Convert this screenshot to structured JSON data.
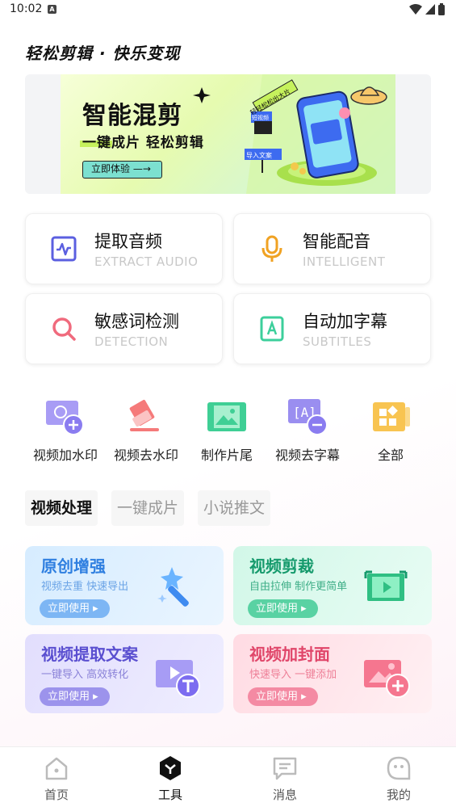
{
  "status_bar": {
    "time": "10:02",
    "notification_glyph": "A"
  },
  "slogan": "轻松剪辑 · 快乐变现",
  "banner": {
    "title": "智能混剪",
    "subtitle": "一键成片  轻松剪辑",
    "button": "立即体验 —→",
    "ribbon": "轻轻松松出大片",
    "tag1": "短视频",
    "tag2": "导入文案"
  },
  "features": [
    {
      "title": "提取音频",
      "subtitle": "EXTRACT AUDIO",
      "icon": "waveform-icon",
      "color": "#5b5fe0"
    },
    {
      "title": "智能配音",
      "subtitle": "INTELLIGENT",
      "icon": "microphone-icon",
      "color": "#f0a223"
    },
    {
      "title": "敏感词检测",
      "subtitle": "DETECTION",
      "icon": "search-icon",
      "color": "#f06a7d"
    },
    {
      "title": "自动加字幕",
      "subtitle": "SUBTITLES",
      "icon": "subtitle-icon",
      "color": "#3ccf9b"
    }
  ],
  "tools": [
    {
      "label": "视频加水印",
      "icon": "add-watermark-icon"
    },
    {
      "label": "视频去水印",
      "icon": "eraser-icon"
    },
    {
      "label": "制作片尾",
      "icon": "film-image-icon"
    },
    {
      "label": "视频去字幕",
      "icon": "remove-subtitle-icon"
    },
    {
      "label": "全部",
      "icon": "all-grid-icon"
    }
  ],
  "tabs": [
    "视频处理",
    "一键成片",
    "小说推文"
  ],
  "process_cards": [
    {
      "title": "原创增强",
      "subtitle": "视频去重 快速导出",
      "button": "立即使用",
      "icon": "magic-wand-icon",
      "title_color": "#2f7fe0",
      "sub_color": "#6aa3e6",
      "btn_color": "#7db6f4"
    },
    {
      "title": "视频剪裁",
      "subtitle": "自由拉伸 制作更简单",
      "button": "立即使用",
      "icon": "crop-video-icon",
      "title_color": "#159a6c",
      "sub_color": "#3eae87",
      "btn_color": "#59d2a3"
    },
    {
      "title": "视频提取文案",
      "subtitle": "一键导入 高效转化",
      "button": "立即使用",
      "icon": "extract-text-icon",
      "title_color": "#5a4fd0",
      "sub_color": "#8a82d8",
      "btn_color": "#9c93ec"
    },
    {
      "title": "视频加封面",
      "subtitle": "快速导入 一键添加",
      "button": "立即使用",
      "icon": "add-cover-icon",
      "title_color": "#e0466a",
      "sub_color": "#ee7f97",
      "btn_color": "#f48aa3"
    }
  ],
  "bottom_nav": [
    {
      "label": "首页",
      "icon": "home-icon"
    },
    {
      "label": "工具",
      "icon": "tools-icon"
    },
    {
      "label": "消息",
      "icon": "message-icon"
    },
    {
      "label": "我的",
      "icon": "profile-icon"
    }
  ]
}
